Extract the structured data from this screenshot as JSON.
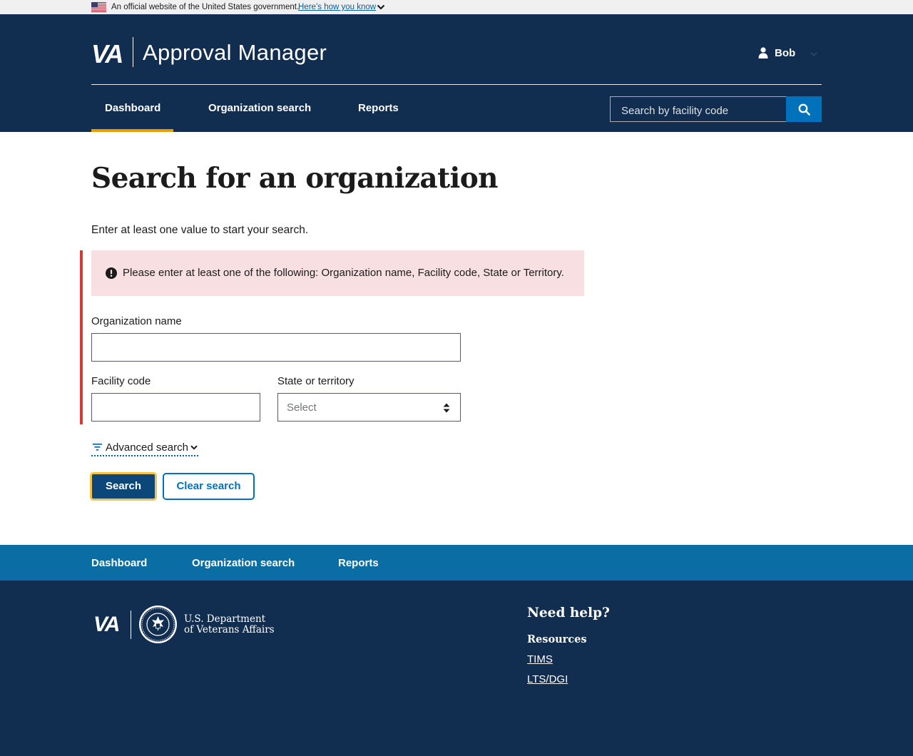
{
  "gov_banner": {
    "text": "An official website of the United States government.",
    "link": "Here’s how you know"
  },
  "header": {
    "logo": "VA",
    "app_title": "Approval Manager",
    "user_name": "Bob",
    "nav": [
      "Dashboard",
      "Organization search",
      "Reports"
    ],
    "active_nav": "Dashboard",
    "search_placeholder": "Search by facility code"
  },
  "main": {
    "title": "Search for an organization",
    "intro": "Enter at least one value to start your search.",
    "alert": "Please enter at least one of the following: Organization name, Facility code, State or Territory.",
    "fields": {
      "org_name_label": "Organization name",
      "org_name_value": "",
      "facility_label": "Facility code",
      "facility_value": "",
      "state_label": "State or territory",
      "state_value": "Select"
    },
    "advanced_search": "Advanced search",
    "search_button": "Search",
    "clear_button": "Clear search"
  },
  "footer": {
    "nav": [
      "Dashboard",
      "Organization search",
      "Reports"
    ],
    "logo": "VA",
    "dept_line1": "U.S. Department",
    "dept_line2": "of Veterans Affairs",
    "help_title": "Need help?",
    "resources_title": "Resources",
    "links": [
      "TIMS",
      "LTS/DGI"
    ]
  },
  "colors": {
    "header_bg": "#112e51",
    "footer_nav_bg": "#0a6ea5",
    "accent_yellow": "#e5a000",
    "primary_blue": "#0071bb",
    "error_red": "#d83933",
    "alert_bg": "#f8dfe2"
  }
}
